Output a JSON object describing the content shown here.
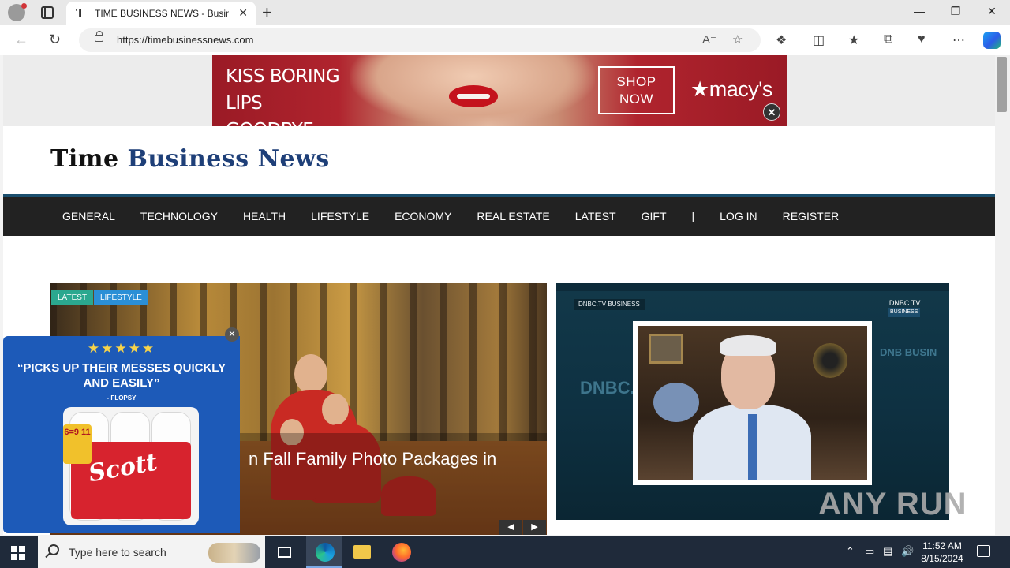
{
  "browser": {
    "tab_favicon": "T",
    "tab_title": "TIME BUSINESS NEWS - Business",
    "url": "https://timebusinessnews.com",
    "new_tab": "+",
    "close_tab": "✕",
    "icons": [
      "profile-icon",
      "tabs-icon",
      "back-icon",
      "refresh-icon",
      "lock-icon",
      "read-aloud-icon",
      "favorite-icon",
      "extensions-icon",
      "split-screen-icon",
      "favorites-icon",
      "collections-icon",
      "browser-essentials-icon",
      "more-icon",
      "copilot-icon"
    ]
  },
  "ad_banner": {
    "headline": "KISS BORING LIPS GOODBYE",
    "cta": "SHOP NOW",
    "brand": "★macy's",
    "close": "✕"
  },
  "site": {
    "logo_first": "Time",
    "logo_rest": "Business News",
    "nav": [
      "GENERAL",
      "TECHNOLOGY",
      "HEALTH",
      "LIFESTYLE",
      "ECONOMY",
      "REAL ESTATE",
      "LATEST",
      "GIFT",
      "|",
      "LOG IN",
      "REGISTER"
    ]
  },
  "hero": {
    "tags": [
      "LATEST",
      "LIFESTYLE"
    ],
    "title": "n Fall Family Photo Packages in"
  },
  "video": {
    "logo_left": "DNBC.TV BUSINESS",
    "logo_right": "DNBC.TV",
    "logo_right_sub": "BUSINESS",
    "bg_text": "DNBC.T BUSINE",
    "bg_text2": "DNB BUSIN"
  },
  "popup_ad": {
    "stars": "★★★★★",
    "quote": "“PICKS UP THEIR MESSES QUICKLY AND EASILY”",
    "attribution": "- FLOPSY",
    "brand": "Scott",
    "badge": "6=9 11",
    "close": "✕"
  },
  "watermark": "ANY RUN",
  "taskbar": {
    "search_placeholder": "Type here to search",
    "time": "11:52 AM",
    "date": "8/15/2024",
    "pinned": [
      "task-view",
      "edge",
      "file-explorer",
      "firefox"
    ]
  }
}
